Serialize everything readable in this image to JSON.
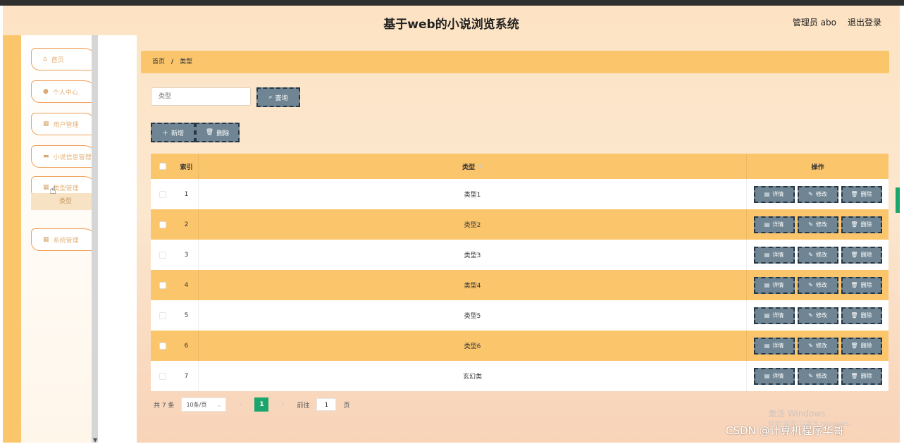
{
  "header": {
    "title": "基于web的小说浏览系统",
    "user": "管理员 abo",
    "logout": "退出登录"
  },
  "sidebar": {
    "items": [
      {
        "label": "首页",
        "icon": "home-icon"
      },
      {
        "label": "个人中心",
        "icon": "user-icon"
      },
      {
        "label": "用户管理",
        "icon": "grid-icon"
      },
      {
        "label": "小说信息管理",
        "icon": "card-icon"
      },
      {
        "label": "类型管理",
        "icon": "grid-icon"
      },
      {
        "label": "系统管理",
        "icon": "grid-icon"
      }
    ],
    "submenu": "类型"
  },
  "breadcrumb": {
    "home": "首页",
    "sep": "/",
    "current": "类型"
  },
  "search": {
    "placeholder": "类型",
    "button": "查询"
  },
  "actions": {
    "add": "新增",
    "delete": "删除"
  },
  "table": {
    "headers": {
      "index": "索引",
      "type": "类型",
      "ops": "操作"
    },
    "rows": [
      {
        "index": "1",
        "type": "类型1"
      },
      {
        "index": "2",
        "type": "类型2"
      },
      {
        "index": "3",
        "type": "类型3"
      },
      {
        "index": "4",
        "type": "类型4"
      },
      {
        "index": "5",
        "type": "类型5"
      },
      {
        "index": "6",
        "type": "类型6"
      },
      {
        "index": "7",
        "type": "玄幻类"
      }
    ],
    "op_labels": {
      "detail": "详情",
      "edit": "修改",
      "delete": "删除"
    }
  },
  "pager": {
    "total": "共 7 条",
    "page_size": "10条/页",
    "current": "1",
    "goto_label": "前往",
    "goto_value": "1",
    "page_unit": "页"
  },
  "watermark": {
    "windows": "激活 Windows",
    "windows_sub": "转到\"设置\"以激活 Windows。",
    "csdn": "CSDN @计算机程序华哥"
  },
  "colors": {
    "accent": "#fbc56c",
    "button": "#6f8593",
    "pager_active": "#19a56c"
  }
}
